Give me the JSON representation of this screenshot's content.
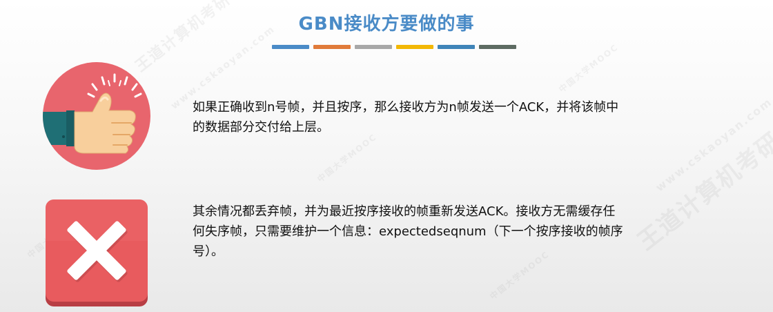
{
  "title": "GBN接收方要做的事",
  "colors": {
    "title": "#4a8bc7",
    "bars": [
      "#4a8bc7",
      "#e07b3a",
      "#a8a8a8",
      "#f2b705",
      "#3f84b8",
      "#5d6b62"
    ],
    "thumb_bg": "#e8656d",
    "x_bg": "#e85b5e"
  },
  "icons": {
    "thumbs_up": "thumbs-up-icon",
    "cross": "cross-icon"
  },
  "watermark_texts": [
    "王道计算机考研",
    "www.cskaoyan.com",
    "中国大学MOOC"
  ],
  "items": [
    {
      "text_lines": [
        "如果正确收到n号帧，并且按序，那么接收方为n帧发送一个ACK，并将该帧中",
        "的数据部分交付给上层。"
      ]
    },
    {
      "text_lines": [
        "其余情况都丢弃帧，并为最近按序接收的帧重新发送ACK。接收方无需缓存任",
        "何失序帧，只需要维护一个信息：expectedseqnum（下一个按序接收的帧序",
        "号）。"
      ]
    }
  ]
}
